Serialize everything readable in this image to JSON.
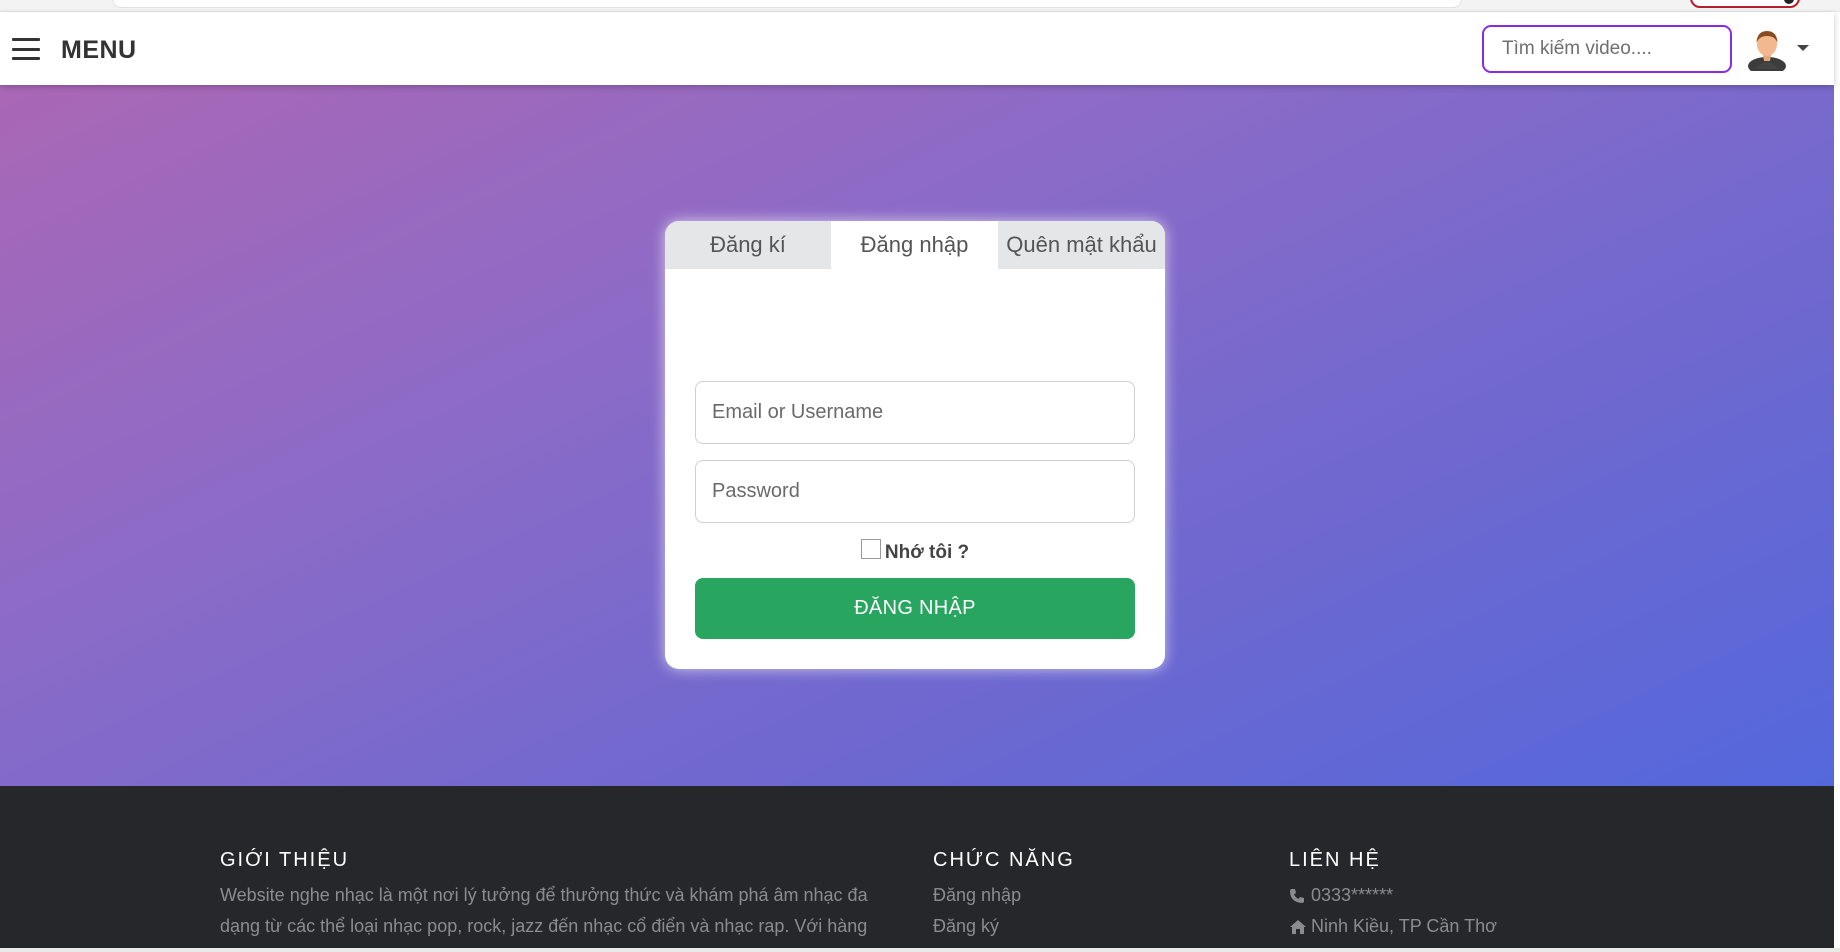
{
  "navbar": {
    "menu_label": "MENU",
    "search_placeholder": "Tìm kiếm video...."
  },
  "auth_card": {
    "tabs": [
      {
        "label": "Đăng kí",
        "active": false
      },
      {
        "label": "Đăng nhập",
        "active": true
      },
      {
        "label": "Quên mật khẩu",
        "active": false
      }
    ],
    "email_placeholder": "Email or Username",
    "password_placeholder": "Password",
    "remember_label": "Nhớ tôi ?",
    "remember_checked": false,
    "submit_label": "ĐĂNG NHẬP"
  },
  "footer": {
    "about": {
      "title": "GIỚI THIỆU",
      "text": "Website nghe nhạc là một nơi lý tưởng để thưởng thức và khám phá âm nhạc đa dạng từ các thể loại nhạc pop, rock, jazz đến nhạc cổ điển và nhạc rap. Với hàng"
    },
    "features": {
      "title": "CHỨC NĂNG",
      "links": [
        "Đăng nhập",
        "Đăng ký"
      ]
    },
    "contact": {
      "title": "LIÊN HỆ",
      "phone": "0333******",
      "address": "Ninh Kiều, TP Cần Thơ"
    }
  },
  "colors": {
    "search_border": "#8a2be2",
    "submit_button": "#28a55f",
    "footer_bg": "#26272b",
    "gradient_start": "#aa67b5",
    "gradient_end": "#5468dc"
  },
  "icons": [
    "hamburger-icon",
    "avatar-icon",
    "caret-down-icon",
    "phone-icon",
    "home-icon"
  ]
}
